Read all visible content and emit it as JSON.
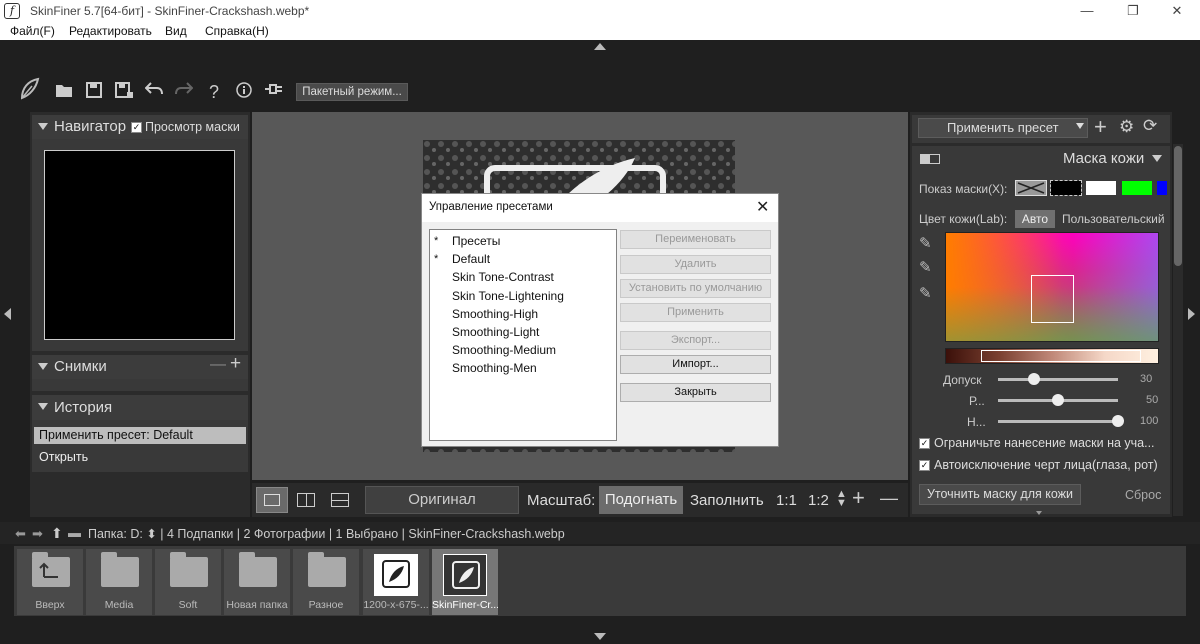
{
  "window": {
    "title": "SkinFiner 5.7[64-бит] - SkinFiner-Crackshash.webp*",
    "minimize": "—",
    "maximize": "❐",
    "close": "✕",
    "app_glyph": "f"
  },
  "menu": [
    "Файл(F)",
    "Редактировать",
    "Вид",
    "Справка(H)"
  ],
  "toolbar": {
    "batch_label": "Пакетный режим..."
  },
  "navigator": {
    "title": "Навигатор",
    "mask_preview": "Просмотр маски"
  },
  "snapshots": {
    "title": "Снимки"
  },
  "history": {
    "title": "История",
    "items": [
      "Применить пресет: Default",
      "Открыть"
    ]
  },
  "preset_dropdown": "Применить пресет",
  "skin_mask": {
    "title": "Маска кожи",
    "show_mask_label": "Показ маски(X):",
    "skin_color_label": "Цвет кожи(Lab):",
    "auto": "Авто",
    "custom": "Пользовательский",
    "sliders": [
      {
        "label": "Допуск",
        "value": "30",
        "level": 0.3
      },
      {
        "label": "Р...",
        "value": "50",
        "level": 0.5
      },
      {
        "label": "Н...",
        "value": "100",
        "level": 1.0
      }
    ],
    "limit_mask": "Ограничьте нанесение маски на уча...",
    "auto_exclude": "Автоисключение черт лица(глаза, рот)",
    "refine_button": "Уточнить маску для кожи",
    "reset": "Сброс",
    "swatch_colors": [
      "#000000",
      "#ffffff",
      "#00ff00",
      "#0000ff"
    ]
  },
  "bottom": {
    "original": "Оригинал",
    "scale_label": "Масштаб:",
    "fit": "Подогнать",
    "fill": "Заполнить",
    "one_to_one": "1:1",
    "one_to_two": "1:2"
  },
  "pathbar": {
    "text": "Папка:  D: ⬍ | 4 Подпапки | 2 Фотографии | 1 Выбрано | SkinFiner-Crackshash.webp"
  },
  "filmstrip": [
    {
      "label": "Вверх",
      "kind": "up"
    },
    {
      "label": "Media",
      "kind": "folder"
    },
    {
      "label": "Soft",
      "kind": "folder"
    },
    {
      "label": "Новая папка",
      "kind": "folder"
    },
    {
      "label": "Разное",
      "kind": "folder"
    },
    {
      "label": "1200-x-675-...",
      "kind": "image"
    },
    {
      "label": "SkinFiner-Cr...",
      "kind": "image-selected"
    }
  ],
  "dialog": {
    "title": "Управление пресетами",
    "presets": [
      {
        "star": "*",
        "name": "Пресеты"
      },
      {
        "star": "*",
        "name": "Default"
      },
      {
        "star": "",
        "name": "Skin Tone-Contrast"
      },
      {
        "star": "",
        "name": "Skin Tone-Lightening"
      },
      {
        "star": "",
        "name": "Smoothing-High"
      },
      {
        "star": "",
        "name": "Smoothing-Light"
      },
      {
        "star": "",
        "name": "Smoothing-Medium"
      },
      {
        "star": "",
        "name": "Smoothing-Men"
      }
    ],
    "buttons": {
      "rename": "Переименовать",
      "delete": "Удалить",
      "set_default": "Установить по умолчанию",
      "apply": "Применить",
      "export": "Экспорт...",
      "import": "Импорт...",
      "close": "Закрыть"
    }
  },
  "colors": {
    "accent_bg": "#1f1f1f",
    "panel": "#393939",
    "dialog": "#f0f0f0"
  }
}
